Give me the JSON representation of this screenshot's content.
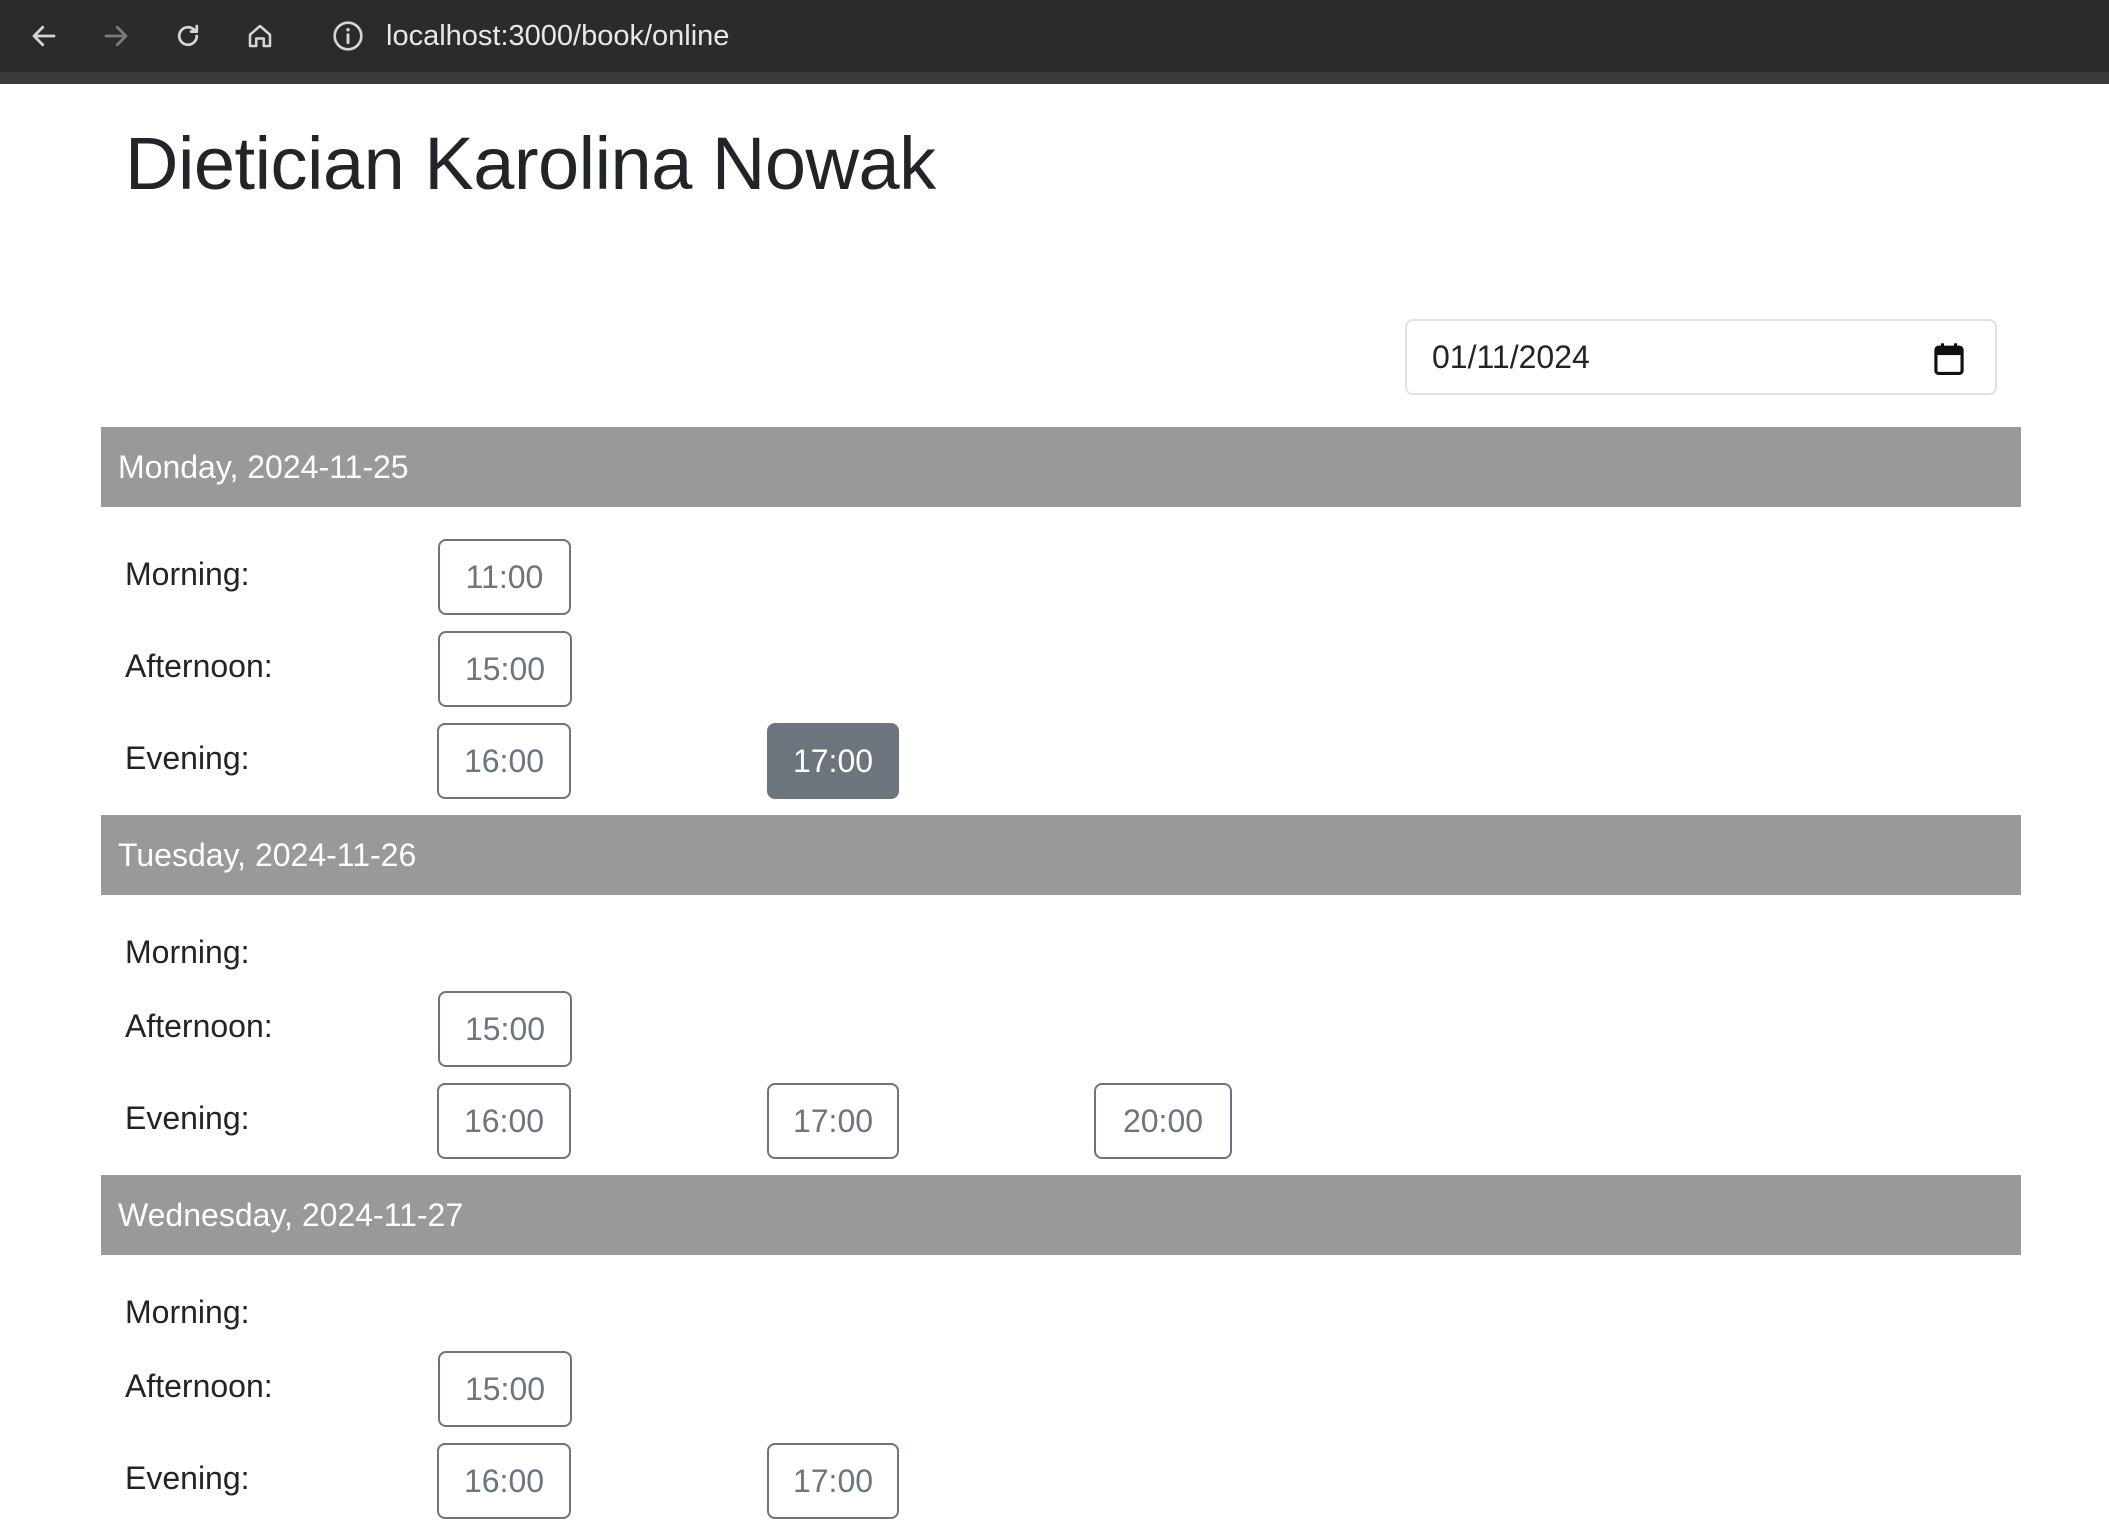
{
  "browser": {
    "url": "localhost:3000/book/online"
  },
  "page": {
    "title": "Dietician Karolina Nowak",
    "date_input": {
      "value": "01/11/2024"
    }
  },
  "days": [
    {
      "header": "Monday, 2024-11-25",
      "morning_label": "Morning:",
      "afternoon_label": "Afternoon:",
      "evening_label": "Evening:",
      "morning": [
        "11:00"
      ],
      "afternoon": [
        "15:00"
      ],
      "evening": [
        "16:00",
        "17:00"
      ],
      "selected": "17:00"
    },
    {
      "header": "Tuesday, 2024-11-26",
      "morning_label": "Morning:",
      "afternoon_label": "Afternoon:",
      "evening_label": "Evening:",
      "morning": [],
      "afternoon": [
        "15:00"
      ],
      "evening": [
        "16:00",
        "17:00",
        "20:00"
      ]
    },
    {
      "header": "Wednesday, 2024-11-27",
      "morning_label": "Morning:",
      "afternoon_label": "Afternoon:",
      "evening_label": "Evening:",
      "morning": [],
      "afternoon": [
        "15:00"
      ],
      "evening": [
        "16:00",
        "17:00"
      ]
    }
  ]
}
